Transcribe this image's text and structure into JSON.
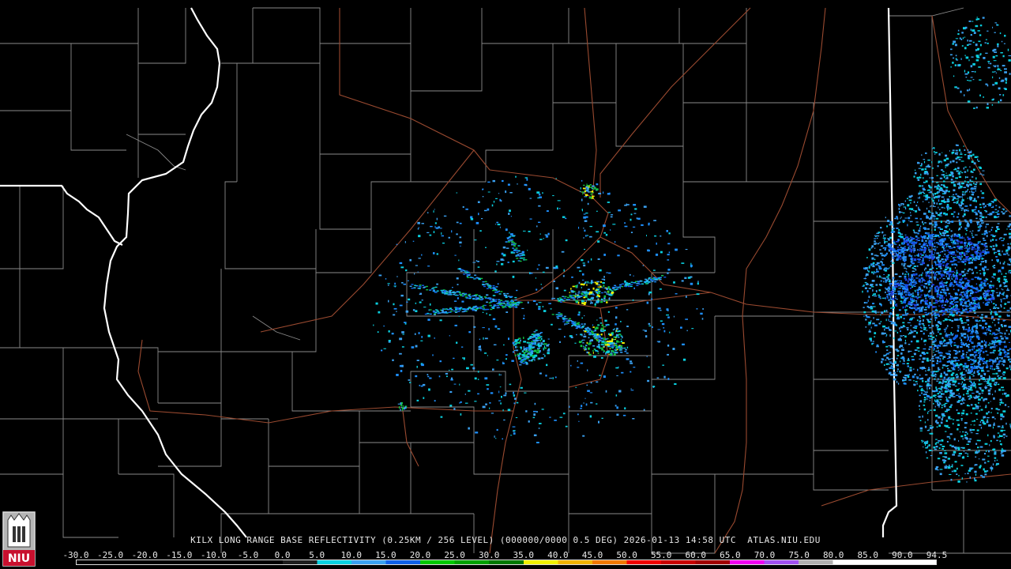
{
  "caption": {
    "site": "KILX",
    "product": "LONG RANGE BASE REFLECTIVITY",
    "resolution": "(0.25KM / 256 LEVEL)",
    "volume": "(000000/0000 0.5 DEG)",
    "timestamp": "2026-01-13 14:58 UTC",
    "source": "ATLAS.NIU.EDU"
  },
  "legend": {
    "unit_values": [
      "-30.0",
      "-25.0",
      "-20.0",
      "-15.0",
      "-10.0",
      "-5.0",
      "0.0",
      "5.0",
      "10.0",
      "15.0",
      "20.0",
      "25.0",
      "30.0",
      "35.0",
      "40.0",
      "45.0",
      "50.0",
      "55.0",
      "60.0",
      "65.0",
      "70.0",
      "75.0",
      "80.0",
      "85.0",
      "90.0",
      "94.5"
    ],
    "colors": [
      "#000000",
      "#000000",
      "#000000",
      "#000000",
      "#000000",
      "#000000",
      "#1e1e1e",
      "#0ad0e0",
      "#3aa0f0",
      "#1060e8",
      "#00c800",
      "#00a000",
      "#007800",
      "#f0f000",
      "#f0b400",
      "#f07800",
      "#f00000",
      "#c80000",
      "#a00000",
      "#f000f0",
      "#a050f0",
      "#b0b0b0",
      "#ffffff",
      "#ffffff",
      "#ffffff"
    ]
  },
  "logo": {
    "text": "NIU",
    "brand_color": "#c8102e"
  }
}
